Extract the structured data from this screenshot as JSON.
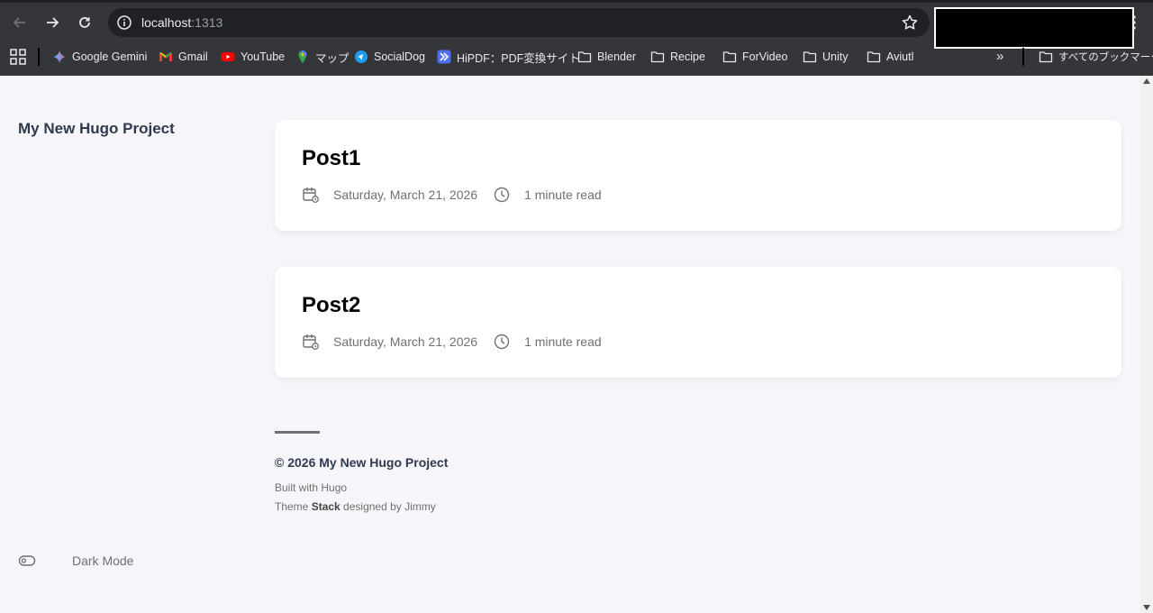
{
  "browser": {
    "url_host": "localhost",
    "url_port": ":1313",
    "bookmarks": [
      {
        "label": "Google Gemini",
        "icon": "gemini-icon"
      },
      {
        "label": "Gmail",
        "icon": "gmail-icon"
      },
      {
        "label": "YouTube",
        "icon": "youtube-icon"
      },
      {
        "label": "マップ",
        "icon": "maps-icon"
      },
      {
        "label": "SocialDog",
        "icon": "socialdog-icon"
      },
      {
        "label": "HiPDF：PDF変換サイト",
        "icon": "hipdf-icon"
      },
      {
        "label": "Blender",
        "icon": "folder-icon"
      },
      {
        "label": "Recipe",
        "icon": "folder-icon"
      },
      {
        "label": "ForVideo",
        "icon": "folder-icon"
      },
      {
        "label": "Unity",
        "icon": "folder-icon"
      },
      {
        "label": "Aviutl",
        "icon": "folder-icon"
      }
    ],
    "more_label": "»",
    "all_bookmarks": "すべてのブックマーク"
  },
  "site": {
    "name": "My New Hugo Project"
  },
  "posts": [
    {
      "title": "Post1",
      "date": "Saturday, March 21, 2026",
      "read_time": "1 minute read"
    },
    {
      "title": "Post2",
      "date": "Saturday, March 21, 2026",
      "read_time": "1 minute read"
    }
  ],
  "footer": {
    "copyright": "© 2026 My New Hugo Project",
    "built_with": "Built with Hugo",
    "theme_prefix": "Theme ",
    "theme_name": "Stack",
    "theme_suffix": " designed by Jimmy"
  },
  "dark_mode_label": "Dark Mode"
}
